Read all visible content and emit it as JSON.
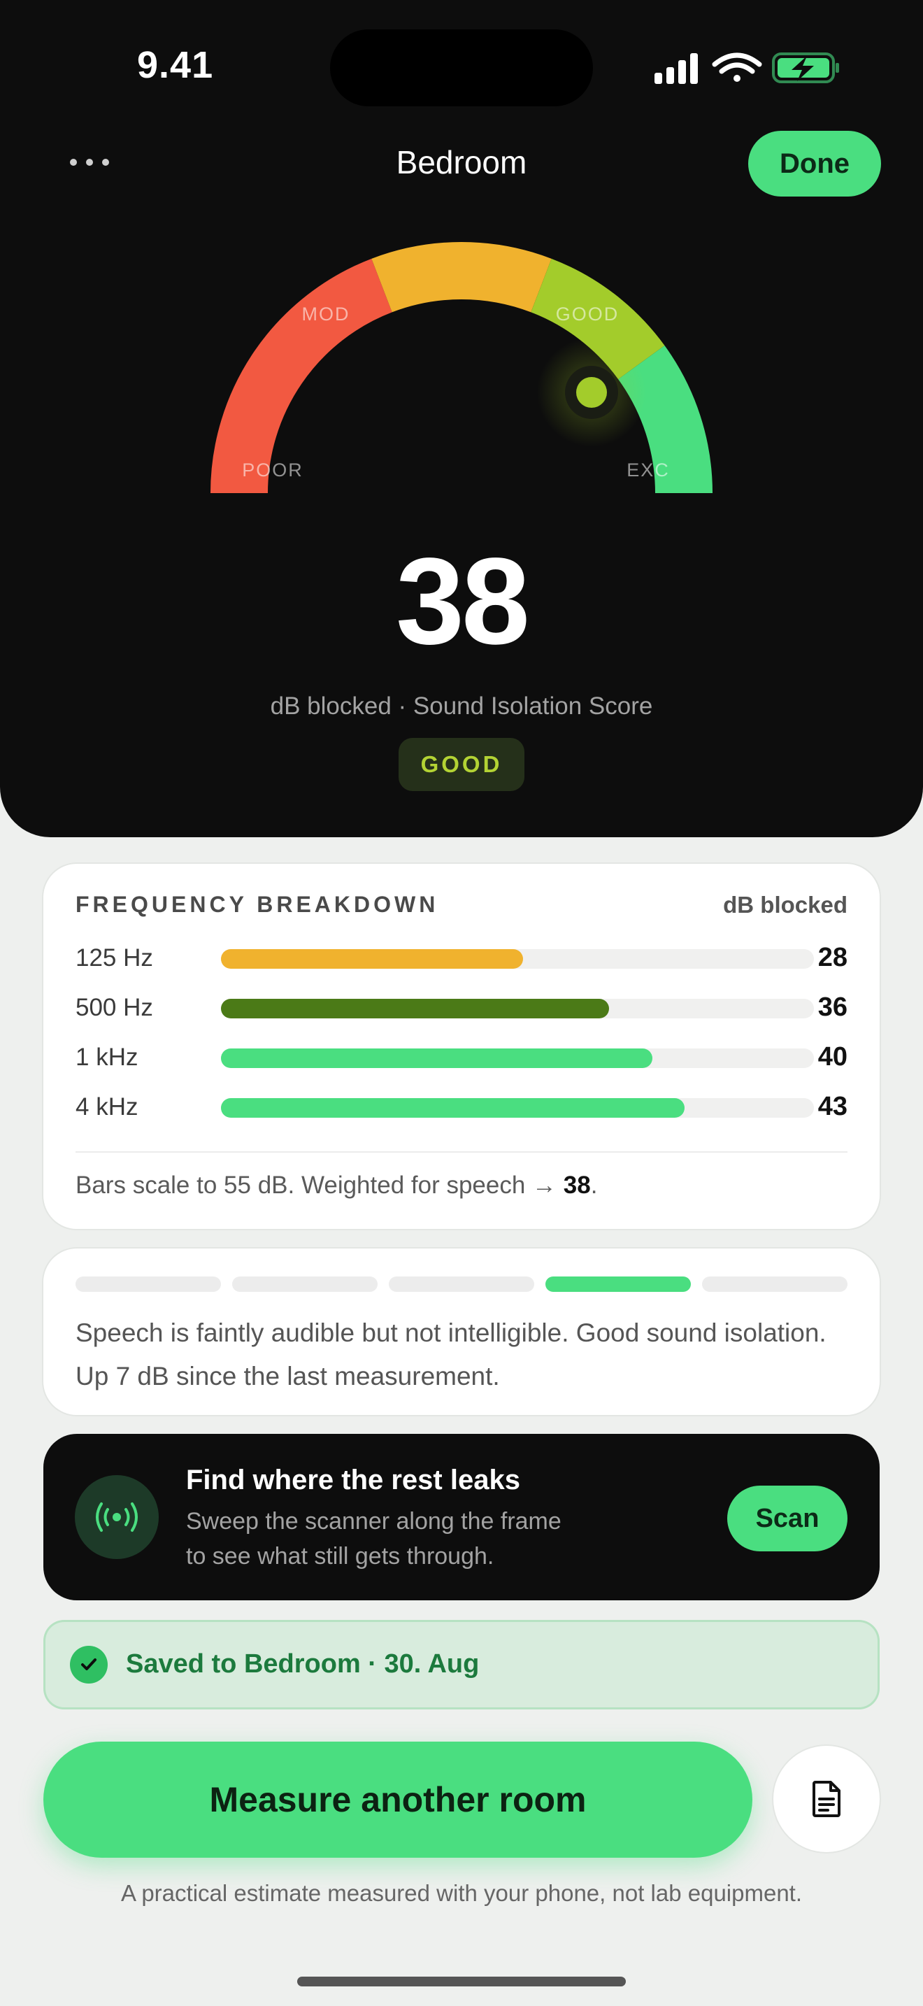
{
  "status_bar": {
    "time": "9.41"
  },
  "header": {
    "title": "Bedroom",
    "done_label": "Done"
  },
  "gauge": {
    "labels": {
      "poor": "POOR",
      "moderate": "MOD",
      "good": "GOOD",
      "excellent": "EXC"
    },
    "score": "38",
    "caption": "dB blocked · Sound Isolation Score",
    "rating": "GOOD",
    "colors": {
      "poor": "#f25941",
      "moderate": "#f0b22e",
      "good": "#a3cc2b",
      "excellent": "#4ade80"
    }
  },
  "frequency": {
    "title": "FREQUENCY BREAKDOWN",
    "unit_label": "dB blocked",
    "scale_max": 55,
    "rows": [
      {
        "label": "125 Hz",
        "value": 28,
        "value_text": "28",
        "color": "#f0b22e"
      },
      {
        "label": "500 Hz",
        "value": 36,
        "value_text": "36",
        "color": "#4b7a17"
      },
      {
        "label": "1 kHz",
        "value": 40,
        "value_text": "40",
        "color": "#4ade80"
      },
      {
        "label": "4 kHz",
        "value": 43,
        "value_text": "43",
        "color": "#4ade80"
      }
    ],
    "note_prefix": "Bars scale to 55 dB. Weighted for speech → ",
    "note_value": "38",
    "note_suffix": "."
  },
  "description": {
    "segments_total": 5,
    "active_segment": 4,
    "text": "Speech is faintly audible but not intelligible. Good sound isolation. Up 7 dB since the last measurement."
  },
  "scan_promo": {
    "icon": "broadcast-icon",
    "title": "Find where the rest leaks",
    "subtitle": "Sweep the scanner along the frame to see what still gets through.",
    "button_label": "Scan"
  },
  "saved": {
    "icon": "check-icon",
    "text": "Saved to Bedroom · 30. Aug"
  },
  "actions": {
    "measure_label": "Measure another room",
    "report_icon": "document-icon"
  },
  "footer": {
    "disclaimer": "A practical estimate measured with your phone, not lab equipment."
  }
}
